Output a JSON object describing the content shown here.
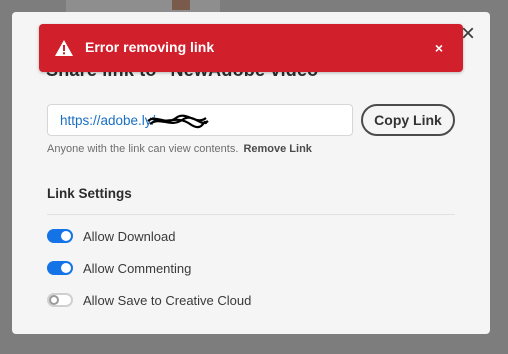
{
  "toast": {
    "message": "Error removing link",
    "dismiss_glyph": "×",
    "color": "#d21f2c"
  },
  "modal": {
    "title_partial": "Share link to \"NewAdobe video\"",
    "close_glyph": "×"
  },
  "link": {
    "url": "https://adobe.ly/",
    "copy_label": "Copy Link",
    "help_text": "Anyone with the link can view contents.",
    "remove_label": "Remove Link"
  },
  "settings": {
    "title": "Link Settings",
    "items": [
      {
        "label": "Allow Download",
        "enabled": true
      },
      {
        "label": "Allow Commenting",
        "enabled": true
      },
      {
        "label": "Allow Save to Creative Cloud",
        "enabled": false
      }
    ]
  },
  "colors": {
    "accent": "#1473e6"
  }
}
